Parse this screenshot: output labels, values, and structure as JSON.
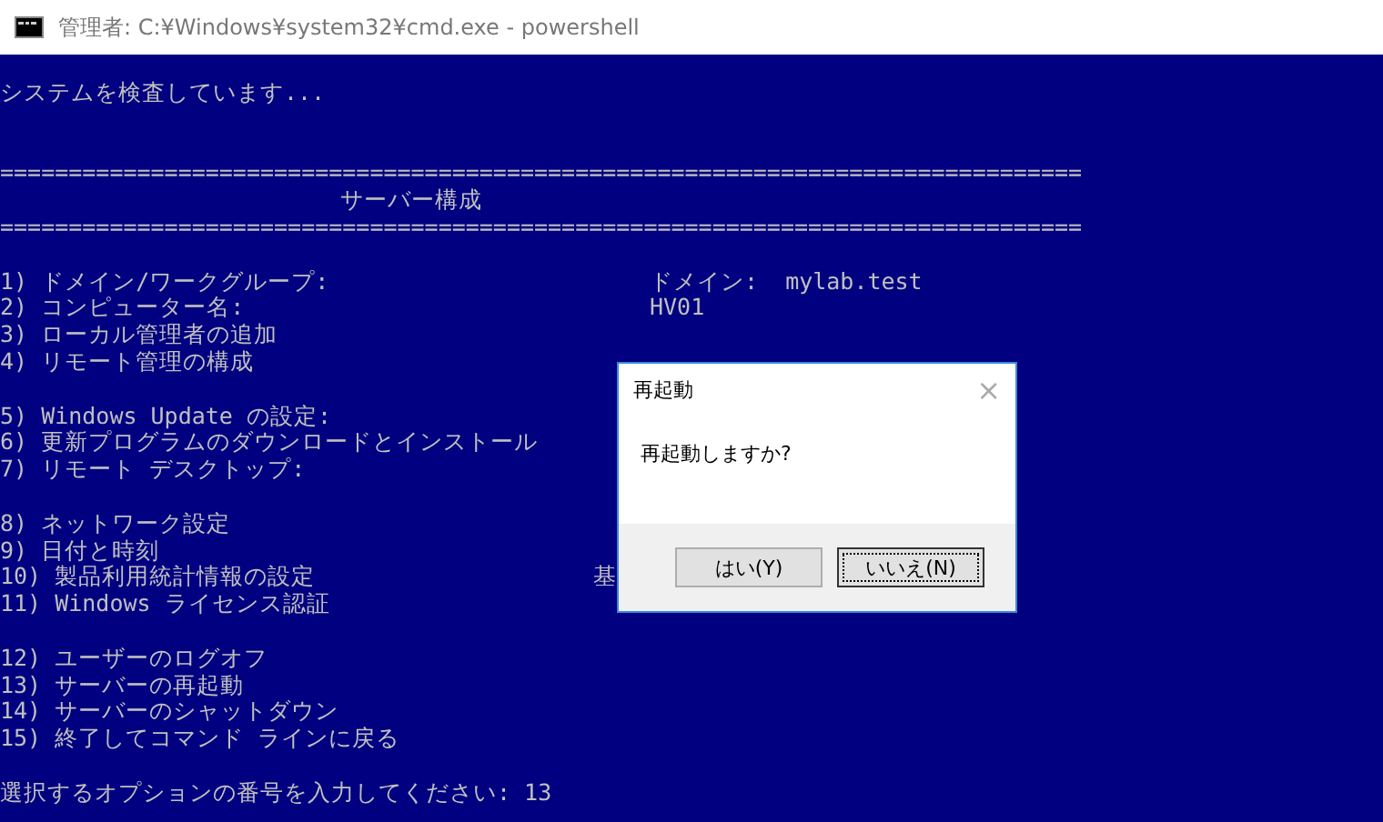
{
  "window": {
    "title": "管理者: C:¥Windows¥system32¥cmd.exe - powershell"
  },
  "console": {
    "status_line": "システムを検査しています...",
    "rule_top": "===============================================================================",
    "heading": "サーバー構成",
    "rule_bottom": "===============================================================================",
    "sections": [
      {
        "items": [
          {
            "label": "1) ドメイン/ワークグループ:",
            "value": "ドメイン:  mylab.test"
          },
          {
            "label": "2) コンピューター名:",
            "value": "HV01"
          },
          {
            "label": "3) ローカル管理者の追加"
          },
          {
            "label": "4) リモート管理の構成"
          }
        ]
      },
      {
        "items": [
          {
            "label": "5) Windows Update の設定:"
          },
          {
            "label": "6) 更新プログラムのダウンロードとインストール"
          },
          {
            "label": "7) リモート デスクトップ:"
          }
        ]
      },
      {
        "items": [
          {
            "label": "8) ネットワーク設定"
          },
          {
            "label": "9) 日付と時刻"
          },
          {
            "label": "10) 製品利用統計情報の設定",
            "value": "基"
          },
          {
            "label": "11) Windows ライセンス認証"
          }
        ]
      },
      {
        "items": [
          {
            "label": "12) ユーザーのログオフ"
          },
          {
            "label": "13) サーバーの再起動"
          },
          {
            "label": "14) サーバーのシャットダウン"
          },
          {
            "label": "15) 終了してコマンド ラインに戻る"
          }
        ]
      }
    ],
    "prompt": "選択するオプションの番号を入力してください: 13"
  },
  "dialog": {
    "title": "再起動",
    "close": "×",
    "message": "再起動しますか?",
    "buttons": [
      {
        "label": "はい(Y)",
        "selected": false
      },
      {
        "label": "いいえ(N)",
        "selected": true
      }
    ]
  }
}
